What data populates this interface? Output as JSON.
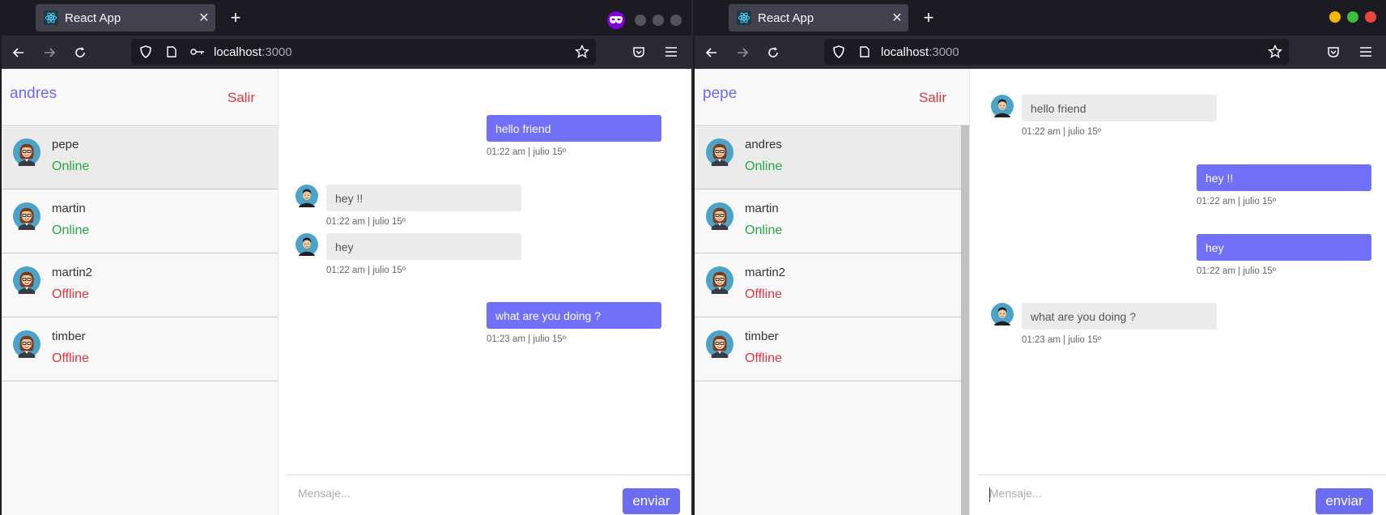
{
  "left_window": {
    "tab_title": "React App",
    "url_host": "localhost",
    "url_port": ":3000",
    "current_user": "andres",
    "logout_label": "Salir",
    "contacts": [
      {
        "name": "pepe",
        "status": "Online",
        "active": true
      },
      {
        "name": "martin",
        "status": "Online",
        "active": false
      },
      {
        "name": "martin2",
        "status": "Offline",
        "active": false
      },
      {
        "name": "timber",
        "status": "Offline",
        "active": false
      }
    ],
    "messages": [
      {
        "direction": "out",
        "text": "hello friend",
        "time": "01:22 am | julio 15º"
      },
      {
        "direction": "in",
        "text": "hey !!",
        "time": "01:22 am | julio 15º"
      },
      {
        "direction": "in",
        "text": "hey",
        "time": "01:22 am | julio 15º"
      },
      {
        "direction": "out",
        "text": "what are you doing ?",
        "time": "01:23 am | julio 15º"
      }
    ],
    "input_placeholder": "Mensaje...",
    "send_label": "enviar"
  },
  "right_window": {
    "tab_title": "React App",
    "url_host": "localhost",
    "url_port": ":3000",
    "current_user": "pepe",
    "logout_label": "Salir",
    "contacts": [
      {
        "name": "andres",
        "status": "Online",
        "active": true
      },
      {
        "name": "martin",
        "status": "Online",
        "active": false
      },
      {
        "name": "martin2",
        "status": "Offline",
        "active": false
      },
      {
        "name": "timber",
        "status": "Offline",
        "active": false
      }
    ],
    "messages": [
      {
        "direction": "in",
        "text": "hello friend",
        "time": "01:22 am | julio 15º"
      },
      {
        "direction": "out",
        "text": "hey !!",
        "time": "01:22 am | julio 15º"
      },
      {
        "direction": "out",
        "text": "hey",
        "time": "01:22 am | julio 15º"
      },
      {
        "direction": "in",
        "text": "what are you doing ?",
        "time": "01:23 am | julio 15º"
      }
    ],
    "input_placeholder": "Mensaje...",
    "send_label": "enviar"
  },
  "colors": {
    "accent": "#6c6cf3",
    "bubble_out": "#7070f8",
    "bubble_in": "#ebebeb",
    "online": "#28a745",
    "offline": "#dc3545"
  },
  "icons": [
    "react-icon",
    "close-icon",
    "plus-icon",
    "private-mask-icon",
    "back-arrow-icon",
    "forward-arrow-icon",
    "reload-icon",
    "shield-icon",
    "page-icon",
    "key-icon",
    "star-icon",
    "pocket-icon",
    "menu-icon",
    "female-avatar-icon",
    "male-avatar-icon"
  ]
}
